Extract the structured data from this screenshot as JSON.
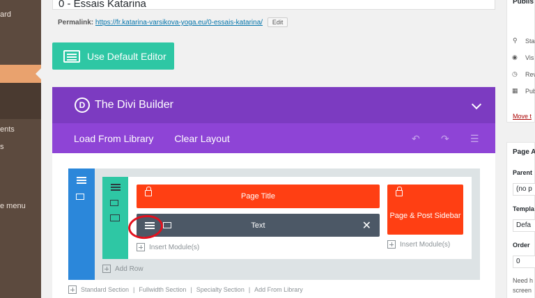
{
  "sidebar": {
    "items": [
      {
        "label": "ard"
      },
      {
        "label": "ents"
      },
      {
        "label": "s"
      },
      {
        "label": "e menu"
      }
    ]
  },
  "post": {
    "title": "0 - Essais Katarina",
    "permalink_label": "Permalink:",
    "permalink_url": "https://fr.katarina-varsikova-yoga.eu/0-essais-katarina/",
    "edit_label": "Edit"
  },
  "default_editor": {
    "label": "Use Default Editor"
  },
  "divi": {
    "title": "The Divi Builder",
    "logo": "D",
    "toolbar": {
      "load_label": "Load From Library",
      "clear_label": "Clear Layout"
    },
    "modules": {
      "page_title": "Page Title",
      "text": "Text",
      "sidebar": "Page & Post Sidebar"
    },
    "insert_module": "Insert Module(s)",
    "add_row": "Add Row",
    "footer": {
      "standard": "Standard Section",
      "fullwidth": "Fullwidth Section",
      "specialty": "Specialty Section",
      "library": "Add From Library",
      "sep": "|"
    }
  },
  "right_panel": {
    "publish_title": "Publis",
    "status": "Sta",
    "visibility": "Vis",
    "revisions": "Rev",
    "publish": "Pub",
    "trash": "Move t",
    "page_attr_title": "Page A",
    "parent_label": "Parent",
    "parent_value": "(no p",
    "template_label": "Templa",
    "template_value": "Defa",
    "order_label": "Order",
    "order_value": "0",
    "help_line1": "Need h",
    "help_line2": "screen"
  },
  "colors": {
    "divi_header": "#7c3bc1",
    "divi_toolbar": "#8e44d6",
    "section_blue": "#2b87da",
    "row_teal": "#2ec7a4",
    "module_red": "#ff3f13",
    "module_dark": "#4c5866",
    "annotation_red": "#e2101d"
  }
}
